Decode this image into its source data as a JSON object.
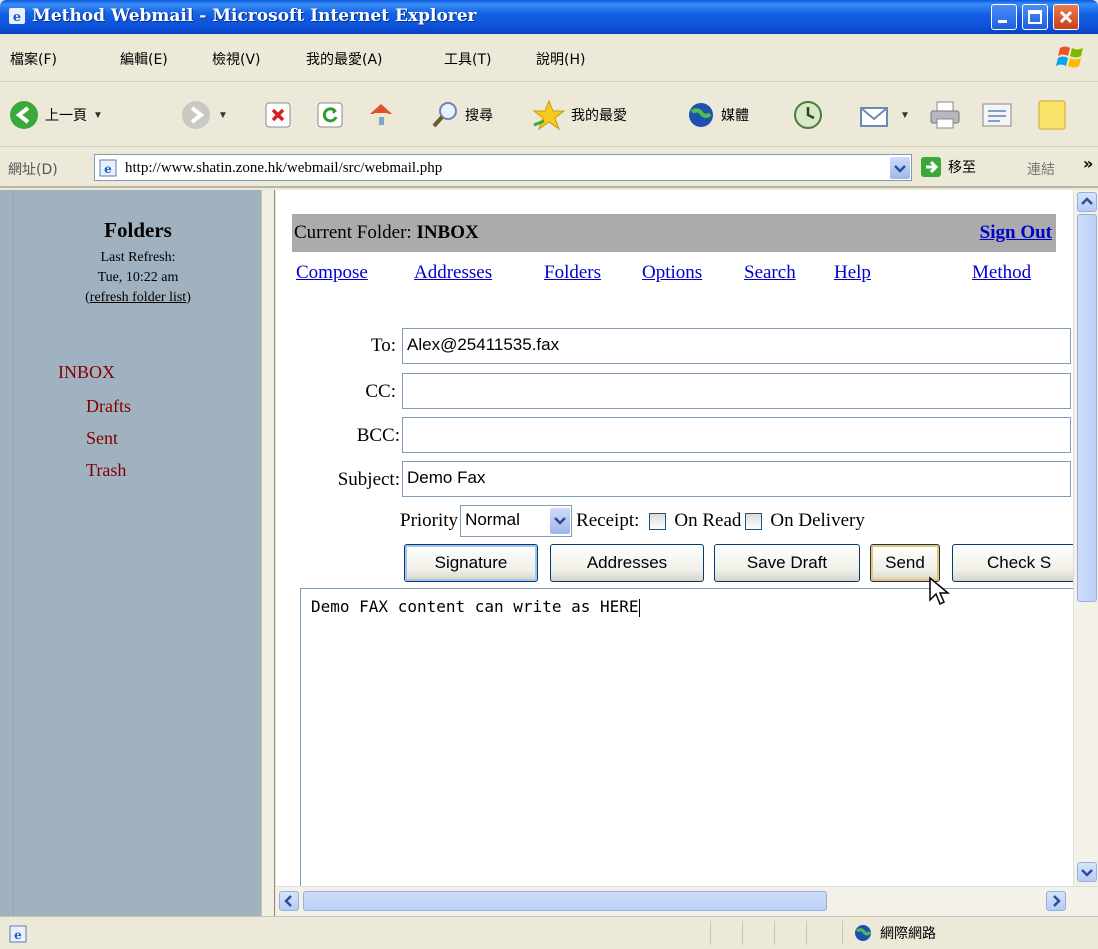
{
  "window": {
    "title": "Method Webmail - Microsoft Internet Explorer",
    "icons": [
      "ie-icon",
      "minimize-icon",
      "maximize-icon",
      "close-icon"
    ]
  },
  "menu": {
    "file": "檔案(F)",
    "edit": "編輯(E)",
    "view": "檢視(V)",
    "favorites": "我的最愛(A)",
    "tools": "工具(T)",
    "help": "說明(H)"
  },
  "toolbar": {
    "back": "上一頁",
    "search": "搜尋",
    "favorites": "我的最愛",
    "media": "媒體"
  },
  "address": {
    "label": "網址(D)",
    "url": "http://www.shatin.zone.hk/webmail/src/webmail.php",
    "go": "移至",
    "links": "連結",
    "more": "»"
  },
  "sidebar": {
    "title": "Folders",
    "last_refresh_label": "Last Refresh:",
    "last_refresh_time": "Tue, 10:22 am",
    "refresh_open": "(",
    "refresh_link": "refresh folder list",
    "refresh_close": ")",
    "folders": [
      {
        "name": "INBOX"
      },
      {
        "name": "Drafts"
      },
      {
        "name": "Sent"
      },
      {
        "name": "Trash"
      }
    ]
  },
  "main": {
    "current_folder_label": "Current Folder: ",
    "current_folder_name": "INBOX",
    "sign_out": "Sign Out",
    "nav": [
      "Compose",
      "Addresses",
      "Folders",
      "Options",
      "Search",
      "Help"
    ],
    "brand_link": "Method"
  },
  "compose": {
    "to_label": "To:",
    "to_value": "Alex@25411535.fax",
    "cc_label": "CC:",
    "cc_value": "",
    "bcc_label": "BCC:",
    "bcc_value": "",
    "subject_label": "Subject:",
    "subject_value": "Demo Fax",
    "priority_label": "Priority",
    "priority_value": "Normal",
    "receipt_label": "Receipt:",
    "on_read": "On Read",
    "on_delivery": "On Delivery",
    "buttons": [
      "Signature",
      "Addresses",
      "Save Draft",
      "Send",
      "Check S"
    ],
    "body": "Demo FAX content can write as HERE"
  },
  "status": {
    "zone": "網際網路"
  },
  "colors": {
    "sidebar_bg": "#a0b2bf",
    "folder_link": "#800000",
    "link": "#0000cc",
    "folder_bar": "#ababab",
    "titlebar": "#0a4ed6"
  }
}
